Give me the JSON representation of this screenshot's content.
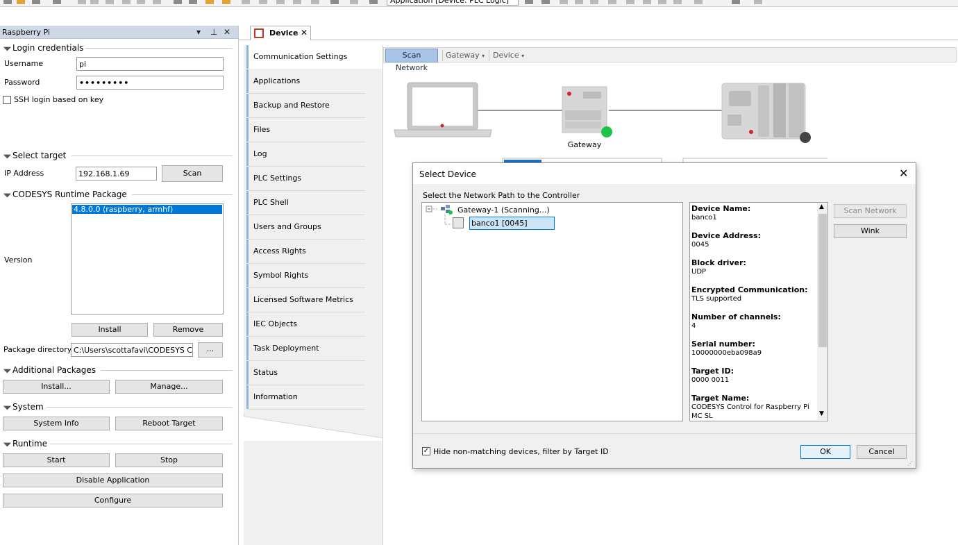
{
  "toolbar": {
    "app_combo": "Application [Device: PLC Logic]"
  },
  "left_panel": {
    "title": "Raspberry Pi",
    "login": {
      "section_label": "Login credentials",
      "username_label": "Username",
      "username_value": "pi",
      "password_label": "Password",
      "password_value": "•••••••••",
      "ssh_label": "SSH login based on key"
    },
    "target": {
      "section_label": "Select target",
      "ip_label": "IP Address",
      "ip_value": "192.168.1.69",
      "scan_label": "Scan"
    },
    "runtime_pkg": {
      "section_label": "CODESYS Runtime Package",
      "version_label": "Version",
      "version_selected": "4.8.0.0 (raspberry, armhf)",
      "install_label": "Install",
      "remove_label": "Remove",
      "pkg_dir_label": "Package directory",
      "pkg_dir_value": "C:\\Users\\scottafavi\\CODESYS Cont",
      "browse_label": "..."
    },
    "additional": {
      "section_label": "Additional Packages",
      "install_label": "Install...",
      "manage_label": "Manage..."
    },
    "system": {
      "section_label": "System",
      "info_label": "System Info",
      "reboot_label": "Reboot Target"
    },
    "runtime": {
      "section_label": "Runtime",
      "start_label": "Start",
      "stop_label": "Stop",
      "disable_label": "Disable Application",
      "configure_label": "Configure"
    }
  },
  "doc_tab": {
    "label": "Device"
  },
  "nav": {
    "items": [
      {
        "label": "Communication Settings"
      },
      {
        "label": "Applications"
      },
      {
        "label": "Backup and Restore"
      },
      {
        "label": "Files"
      },
      {
        "label": "Log"
      },
      {
        "label": "PLC Settings"
      },
      {
        "label": "PLC Shell"
      },
      {
        "label": "Users and Groups"
      },
      {
        "label": "Access Rights"
      },
      {
        "label": "Symbol Rights"
      },
      {
        "label": "Licensed Software Metrics"
      },
      {
        "label": "IEC Objects"
      },
      {
        "label": "Task Deployment"
      },
      {
        "label": "Status"
      },
      {
        "label": "Information"
      }
    ]
  },
  "gateway_toolbar": {
    "scan_label": "Scan Network",
    "gateway_label": "Gateway",
    "device_label": "Device"
  },
  "diagram": {
    "gateway_label": "Gateway",
    "gateway_status_color": "#1ec34a",
    "device_status_color": "#444444"
  },
  "dialog": {
    "title": "Select Device",
    "subtitle": "Select the Network Path to the Controller",
    "tree": {
      "gateway": "Gateway-1 (Scanning...)",
      "device": "banco1 [0045]"
    },
    "info": [
      {
        "key": "Device Name:",
        "value": "banco1"
      },
      {
        "key": "Device Address:",
        "value": "0045"
      },
      {
        "key": "Block driver:",
        "value": "UDP"
      },
      {
        "key": "Encrypted Communication:",
        "value": "TLS supported"
      },
      {
        "key": "Number of channels:",
        "value": "4"
      },
      {
        "key": "Serial number:",
        "value": "10000000eba098a9"
      },
      {
        "key": "Target ID:",
        "value": "0000 0011"
      },
      {
        "key": "Target Name:",
        "value": "CODESYS Control for Raspberry Pi"
      },
      {
        "key": "",
        "value": "MC SL"
      }
    ],
    "scan_network_label": "Scan Network",
    "wink_label": "Wink",
    "filter_label": "Hide non-matching devices, filter by Target ID",
    "ok_label": "OK",
    "cancel_label": "Cancel"
  }
}
